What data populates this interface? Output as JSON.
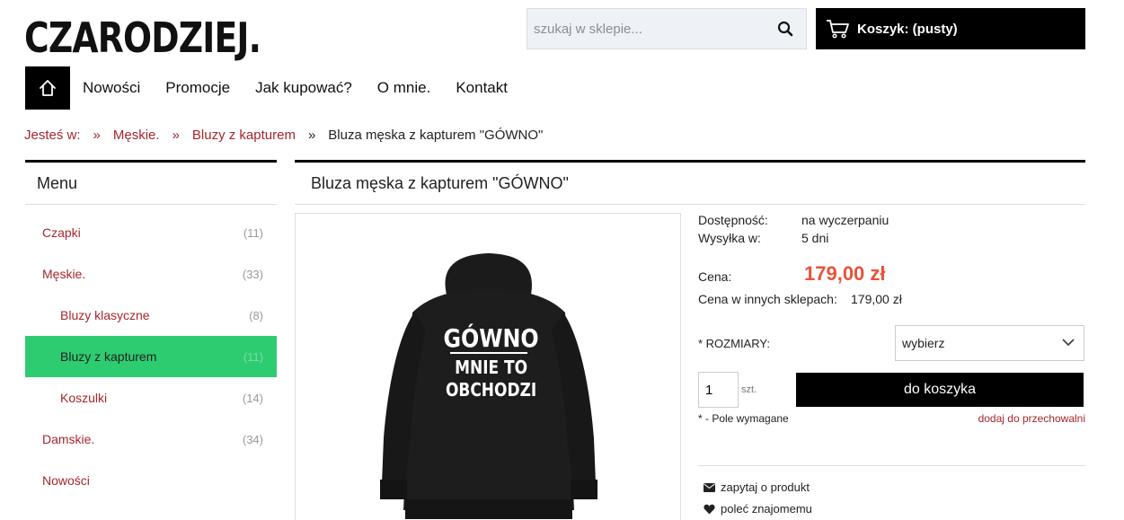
{
  "header": {
    "logo": "CZARODZIEJ.",
    "search_placeholder": "szukaj w sklepie...",
    "cart_label": "Koszyk: (pusty)"
  },
  "nav": {
    "items": [
      "Nowości",
      "Promocje",
      "Jak kupować?",
      "O mnie.",
      "Kontakt"
    ]
  },
  "breadcrumb": {
    "prefix": "Jesteś w:",
    "separator": "»",
    "items": [
      "Męskie.",
      "Bluzy z kapturem",
      "Bluza męska z kapturem \"GÓWNO\""
    ]
  },
  "sidebar": {
    "title": "Menu",
    "categories": [
      {
        "name": "Czapki",
        "count": "(11)"
      },
      {
        "name": "Męskie.",
        "count": "(33)"
      },
      {
        "name": "Bluzy klasyczne",
        "count": "(8)"
      },
      {
        "name": "Bluzy z kapturem",
        "count": "(11)"
      },
      {
        "name": "Koszulki",
        "count": "(14)"
      },
      {
        "name": "Damskie.",
        "count": "(34)"
      },
      {
        "name": "Nowości",
        "count": ""
      }
    ]
  },
  "product": {
    "title": "Bluza męska z kapturem \"GÓWNO\"",
    "print_lines": [
      "GÓWNO",
      "MNIE TO",
      "OBCHODZI"
    ],
    "availability_label": "Dostępność:",
    "availability_value": "na wyczerpaniu",
    "shipping_label": "Wysyłka w:",
    "shipping_value": "5 dni",
    "price_label": "Cena:",
    "price": "179,00 zł",
    "other_price_label": "Cena w innych sklepach:",
    "other_price": "179,00 zł",
    "sizes_label": "* ROZMIARY:",
    "size_selected": "wybierz",
    "quantity": "1",
    "qty_unit": "szt.",
    "add_to_cart": "do koszyka",
    "required_note": "* - Pole wymagane",
    "wishlist": "dodaj do przechowalni",
    "ask_product": "zapytaj o produkt",
    "recommend": "poleć znajomemu"
  },
  "colors": {
    "accent_green": "#2ecc71",
    "link_red": "#a7262b",
    "price_red": "#e8533b"
  }
}
